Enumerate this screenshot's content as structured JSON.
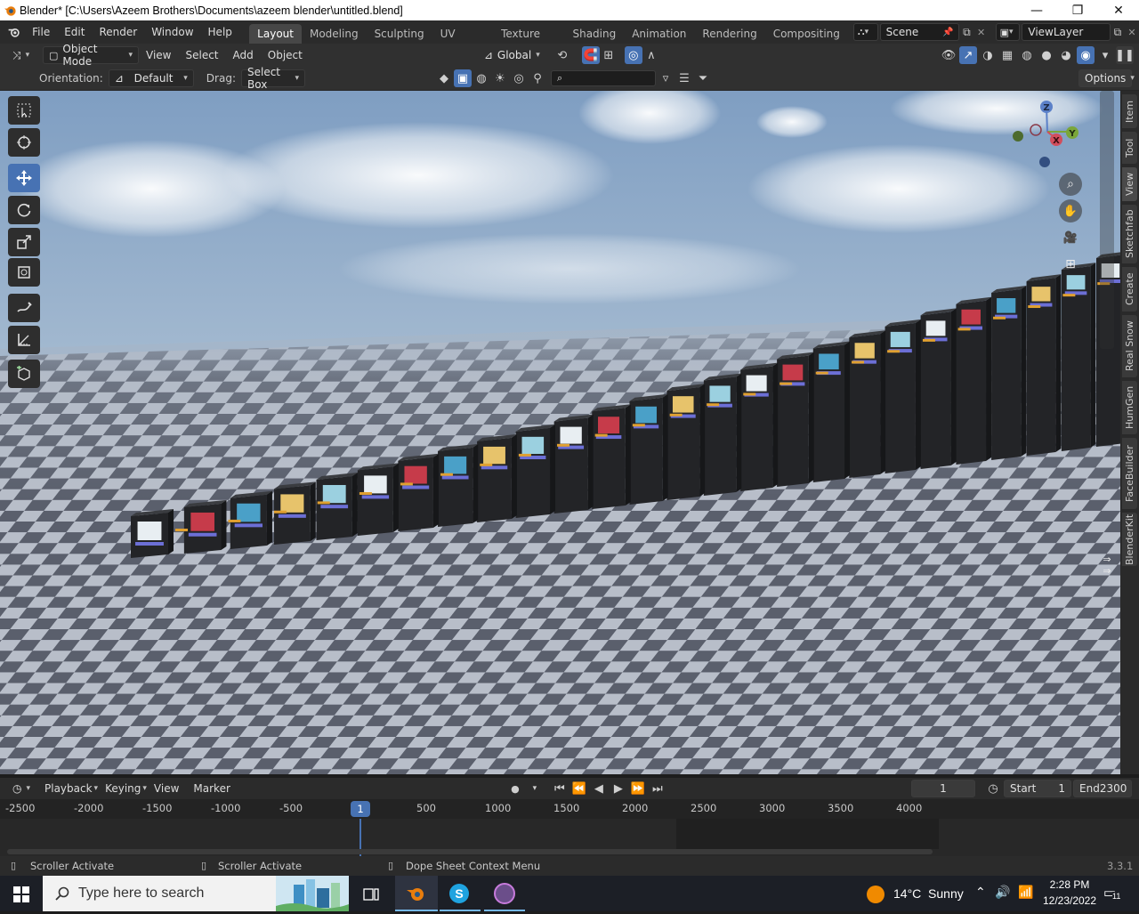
{
  "window": {
    "title": "Blender* [C:\\Users\\Azeem Brothers\\Documents\\azeem blender\\untitled.blend]",
    "minimize": "—",
    "maximize": "❐",
    "close": "✕"
  },
  "menu": [
    "File",
    "Edit",
    "Render",
    "Window",
    "Help"
  ],
  "workspaces": {
    "active": "Layout",
    "tabs": [
      "Layout",
      "Modeling",
      "Sculpting",
      "UV Editing",
      "Texture Paint",
      "Shading",
      "Animation",
      "Rendering",
      "Compositing"
    ]
  },
  "scene": {
    "name": "Scene",
    "view_layer": "ViewLayer"
  },
  "viewport_header": {
    "mode": "Object Mode",
    "menus": [
      "View",
      "Select",
      "Add",
      "Object"
    ],
    "transform_orientation": "Global"
  },
  "tool_settings": {
    "orientation_label": "Orientation:",
    "orientation_value": "Default",
    "drag_label": "Drag:",
    "drag_value": "Select Box",
    "options": "Options"
  },
  "sidebar_tabs": [
    "Item",
    "Tool",
    "View",
    "Sketchfab",
    "Create",
    "Real Snow",
    "HumGen",
    "FaceBuilder",
    "BlenderKit"
  ],
  "gizmo": {
    "z": "Z",
    "y": "Y",
    "x": "X"
  },
  "timeline": {
    "menus": [
      "Playback",
      "Keying",
      "View",
      "Marker"
    ],
    "current_frame": "1",
    "start_label": "Start",
    "start": "1",
    "end_label": "End",
    "end": "2300",
    "ruler": [
      "-2500",
      "-2000",
      "-1500",
      "-1000",
      "-500",
      "1",
      "500",
      "1000",
      "1500",
      "2000",
      "2500",
      "3000",
      "3500",
      "4000"
    ]
  },
  "statusbar": {
    "left": "Scroller Activate",
    "middle": "Scroller Activate",
    "right": "Dope Sheet Context Menu",
    "version": "3.3.1"
  },
  "taskbar": {
    "search_placeholder": "Type here to search",
    "weather": "14°C  Sunny",
    "time": "2:28 PM",
    "date": "12/23/2022",
    "notifications": "11"
  },
  "colors": {
    "accent": "#4772b3",
    "active_frame": "#4772b3",
    "header_bg": "#303030",
    "sky": "#9fb4c9"
  }
}
